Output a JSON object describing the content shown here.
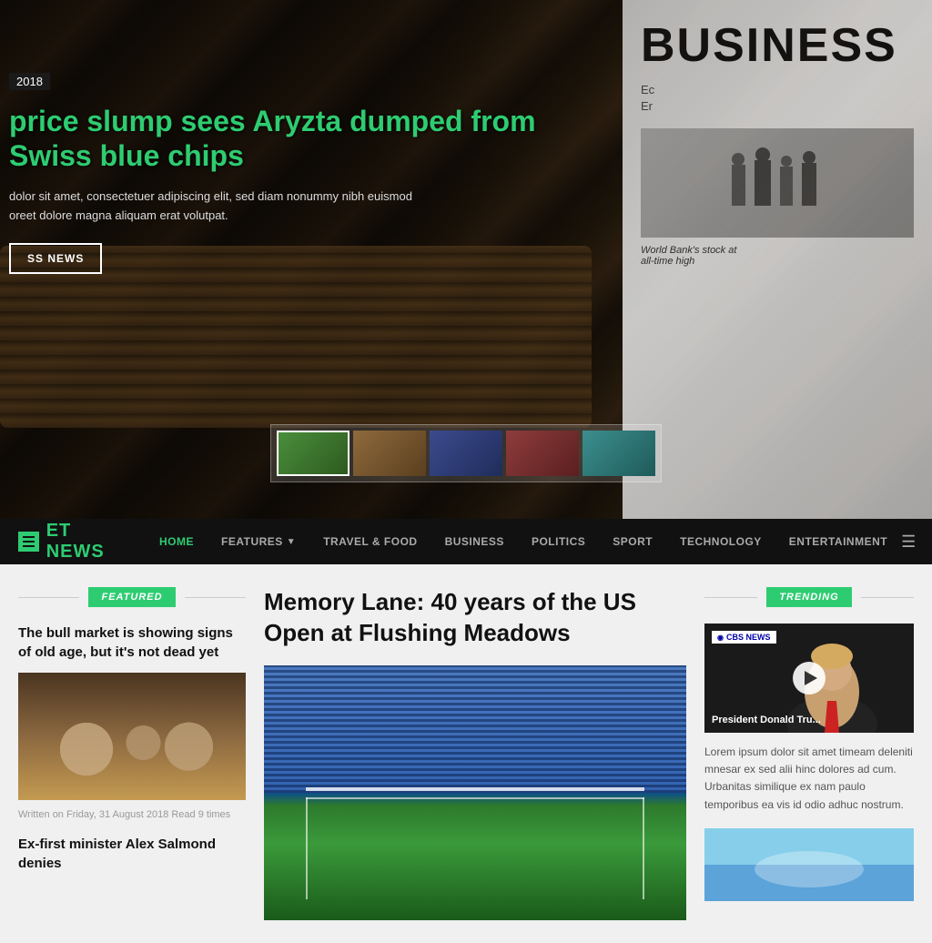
{
  "hero": {
    "date": "2018",
    "headline": "price slump sees Aryzta dumped from Swiss blue chips",
    "description_line1": "dolor sit amet, consectetuer adipiscing elit, sed diam nonummy nibh euismod",
    "description_line2": "oreet dolore magna aliquam erat volutpat.",
    "button_label": "SS NEWS",
    "newspaper_title": "BUSINESS",
    "newspaper_sub1": "Ec",
    "newspaper_sub2": "Er",
    "newspaper_caption1": "World Bank's stock at",
    "newspaper_caption2": "all-time high"
  },
  "navbar": {
    "logo_text": "ET NEWS",
    "logo_prefix": "ET",
    "nav_items": [
      {
        "label": "HOME",
        "active": true,
        "has_arrow": false
      },
      {
        "label": "FEATURES",
        "active": false,
        "has_arrow": true
      },
      {
        "label": "TRAVEL & FOOD",
        "active": false,
        "has_arrow": false
      },
      {
        "label": "BUSINESS",
        "active": false,
        "has_arrow": false
      },
      {
        "label": "POLITICS",
        "active": false,
        "has_arrow": false
      },
      {
        "label": "SPORT",
        "active": false,
        "has_arrow": false
      },
      {
        "label": "TECHNOLOGY",
        "active": false,
        "has_arrow": false
      },
      {
        "label": "ENTERTAINMENT",
        "active": false,
        "has_arrow": false
      }
    ]
  },
  "featured": {
    "section_label": "FEATURED",
    "article1": {
      "title": "The bull market is showing signs of old age, but it's not dead yet",
      "meta": "Written on Friday, 31 August 2018 Read 9 times"
    },
    "article2": {
      "title": "Ex-first minister Alex Salmond denies"
    }
  },
  "main_article": {
    "title": "Memory Lane: 40 years of the US Open at Flushing Meadows"
  },
  "trending": {
    "section_label": "TRENDING",
    "video": {
      "badge": "CBS NEWS",
      "title": "President Donald Tru..."
    },
    "description": "Lorem ipsum dolor sit amet timeam deleniti mnesar ex sed alii hinc dolores ad cum. Urbanitas similique ex nam paulo temporibus ea vis id odio adhuc nostrum."
  }
}
